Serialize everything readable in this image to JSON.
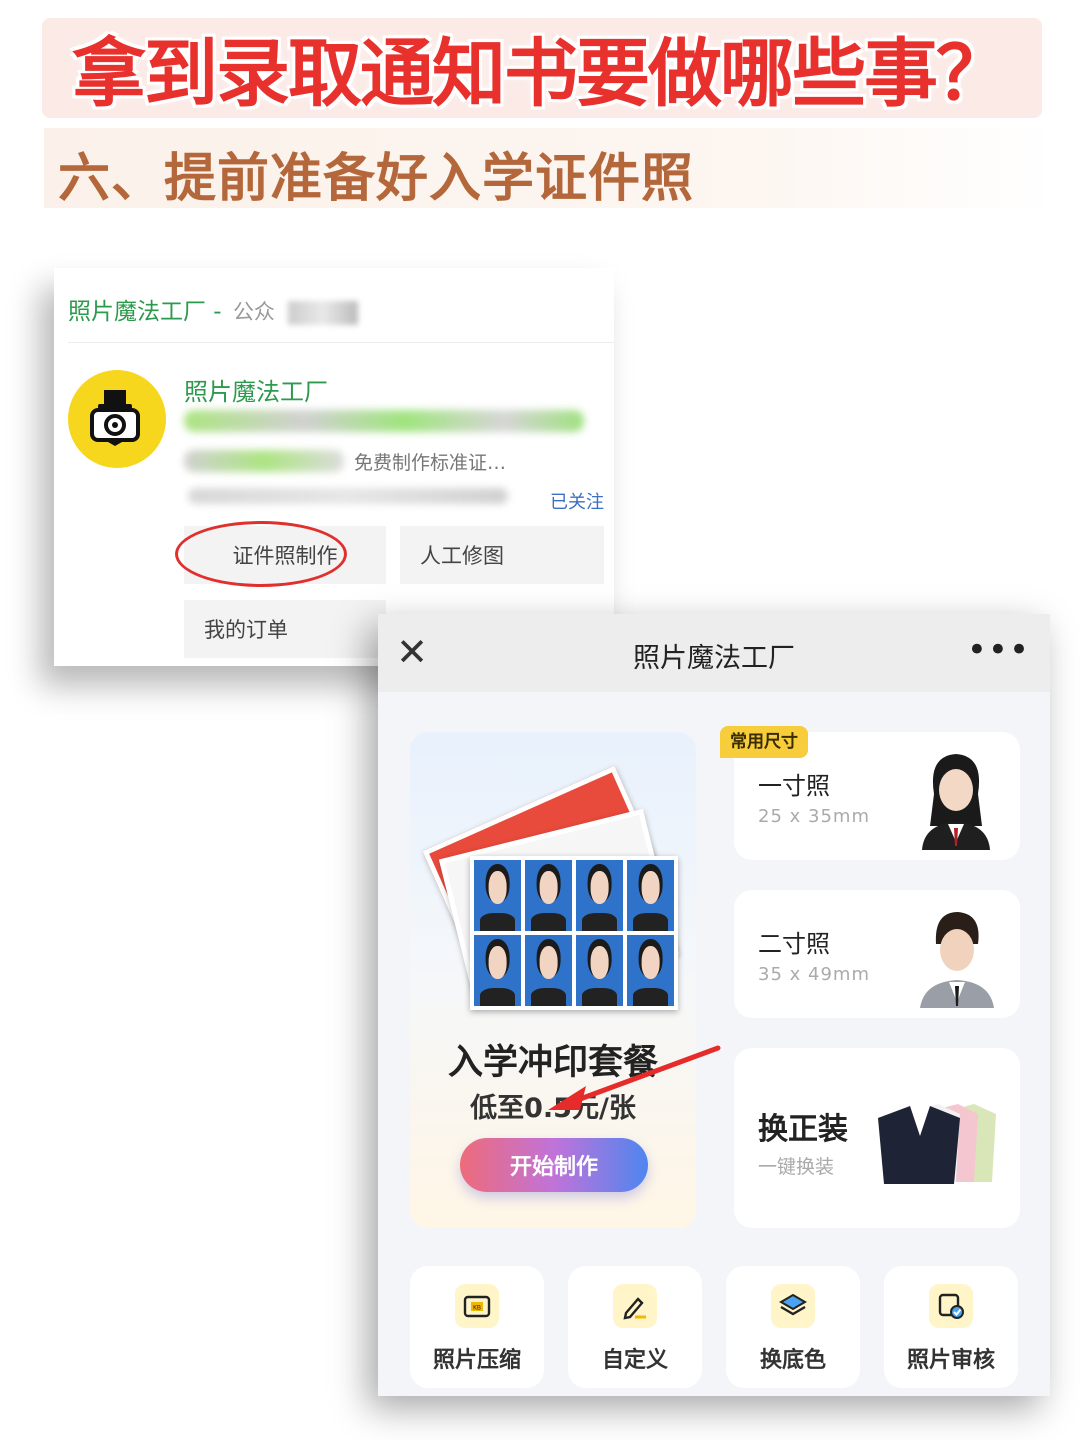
{
  "headline": "拿到录取通知书要做哪些事？",
  "subhead": "六、提前准备好入学证件照",
  "account_card": {
    "header_title": "照片魔法工厂 -",
    "header_obscured": "公众",
    "name": "照片魔法工厂",
    "desc_visible": "免费制作标准证…",
    "follow_label": "已关注",
    "menu": {
      "photo_make": "证件照制作",
      "retouch": "人工修图",
      "orders": "我的订单"
    }
  },
  "mini_program": {
    "title": "照片魔法工厂",
    "close_icon": "close-icon",
    "more_icon": "more-icon",
    "promo": {
      "title": "入学冲印套餐",
      "price": "低至0.5元/张",
      "button": "开始制作"
    },
    "tag": "常用尺寸",
    "sizes": [
      {
        "name": "一寸照",
        "dim": "25 x 35mm"
      },
      {
        "name": "二寸照",
        "dim": "35 x 49mm"
      }
    ],
    "suit": {
      "name": "换正装",
      "sub": "一键换装"
    },
    "tools": [
      {
        "label": "照片压缩",
        "icon": "kb-compress-icon"
      },
      {
        "label": "自定义",
        "icon": "pen-edit-icon"
      },
      {
        "label": "换底色",
        "icon": "layers-icon"
      },
      {
        "label": "照片审核",
        "icon": "photo-check-icon"
      }
    ]
  },
  "colors": {
    "headline_red": "#e8302d",
    "subhead_brown": "#b3673a",
    "wechat_green": "#2c9a4d",
    "brand_yellow": "#f7d61e"
  }
}
